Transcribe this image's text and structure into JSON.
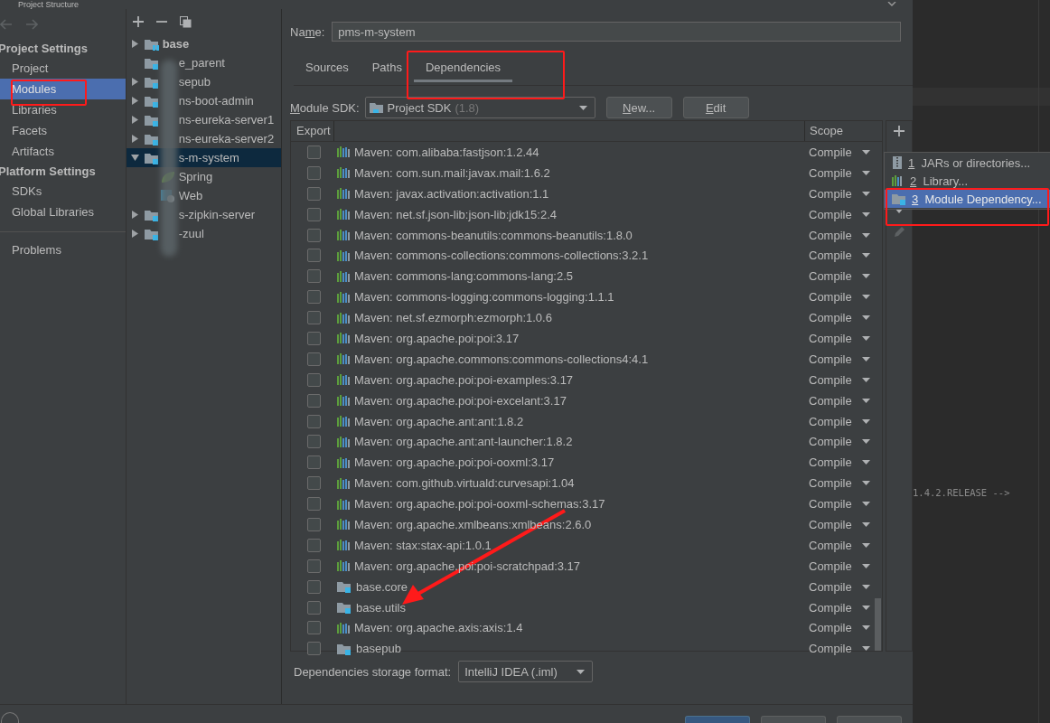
{
  "window": {
    "title": "Project Structure"
  },
  "sidebar": {
    "sections": [
      {
        "title": "Project Settings",
        "items": [
          {
            "label": "Project",
            "selected": false
          },
          {
            "label": "Modules",
            "selected": true
          },
          {
            "label": "Libraries",
            "selected": false
          },
          {
            "label": "Facets",
            "selected": false
          },
          {
            "label": "Artifacts",
            "selected": false
          }
        ]
      },
      {
        "title": "Platform Settings",
        "items": [
          {
            "label": "SDKs",
            "selected": false
          },
          {
            "label": "Global Libraries",
            "selected": false
          }
        ]
      }
    ],
    "problems": {
      "label": "Problems",
      "selected": false
    }
  },
  "tree": [
    {
      "label": "base",
      "kind": "root",
      "expandable": true,
      "expanded": false,
      "selected": false
    },
    {
      "label": "e_parent",
      "kind": "module",
      "expandable": false,
      "selected": false
    },
    {
      "label": "sepub",
      "kind": "module",
      "expandable": true,
      "expanded": false,
      "selected": false
    },
    {
      "label": "ns-boot-admin",
      "kind": "module",
      "expandable": true,
      "expanded": false,
      "selected": false
    },
    {
      "label": "ns-eureka-server1",
      "kind": "module",
      "expandable": true,
      "expanded": false,
      "selected": false
    },
    {
      "label": "ns-eureka-server2",
      "kind": "module",
      "expandable": true,
      "expanded": false,
      "selected": false
    },
    {
      "label": "s-m-system",
      "kind": "module",
      "expandable": true,
      "expanded": true,
      "selected": true,
      "children": [
        {
          "label": "Spring",
          "kind": "spring",
          "selected": false
        },
        {
          "label": "Web",
          "kind": "web",
          "selected": false
        }
      ]
    },
    {
      "label": "s-zipkin-server",
      "kind": "module",
      "expandable": true,
      "expanded": false,
      "selected": false
    },
    {
      "label": "-zuul",
      "kind": "module",
      "expandable": true,
      "expanded": false,
      "selected": false
    }
  ],
  "name_field": {
    "label": {
      "before": "Na",
      "key": "m",
      "rest": "e:"
    },
    "value": "pms-m-system"
  },
  "tabs": [
    {
      "label": "Sources",
      "selected": false
    },
    {
      "label": "Paths",
      "selected": false
    },
    {
      "label": "Dependencies",
      "selected": true
    }
  ],
  "module_sdk": {
    "label": {
      "key": "M",
      "rest": "odule SDK:"
    },
    "value": "Project SDK",
    "version": "(1.8)",
    "buttons": [
      {
        "key": "N",
        "rest": "ew..."
      },
      {
        "key": "E",
        "rest": "dit"
      }
    ]
  },
  "table": {
    "columns": [
      "Export",
      "Scope"
    ],
    "rows": [
      {
        "kind": "library",
        "name": "Maven: com.alibaba:fastjson:1.2.44",
        "export": false,
        "scope": "Compile"
      },
      {
        "kind": "library",
        "name": "Maven: com.sun.mail:javax.mail:1.6.2",
        "export": false,
        "scope": "Compile"
      },
      {
        "kind": "library",
        "name": "Maven: javax.activation:activation:1.1",
        "export": false,
        "scope": "Compile"
      },
      {
        "kind": "library",
        "name": "Maven: net.sf.json-lib:json-lib:jdk15:2.4",
        "export": false,
        "scope": "Compile"
      },
      {
        "kind": "library",
        "name": "Maven: commons-beanutils:commons-beanutils:1.8.0",
        "export": false,
        "scope": "Compile"
      },
      {
        "kind": "library",
        "name": "Maven: commons-collections:commons-collections:3.2.1",
        "export": false,
        "scope": "Compile"
      },
      {
        "kind": "library",
        "name": "Maven: commons-lang:commons-lang:2.5",
        "export": false,
        "scope": "Compile"
      },
      {
        "kind": "library",
        "name": "Maven: commons-logging:commons-logging:1.1.1",
        "export": false,
        "scope": "Compile"
      },
      {
        "kind": "library",
        "name": "Maven: net.sf.ezmorph:ezmorph:1.0.6",
        "export": false,
        "scope": "Compile"
      },
      {
        "kind": "library",
        "name": "Maven: org.apache.poi:poi:3.17",
        "export": false,
        "scope": "Compile"
      },
      {
        "kind": "library",
        "name": "Maven: org.apache.commons:commons-collections4:4.1",
        "export": false,
        "scope": "Compile"
      },
      {
        "kind": "library",
        "name": "Maven: org.apache.poi:poi-examples:3.17",
        "export": false,
        "scope": "Compile"
      },
      {
        "kind": "library",
        "name": "Maven: org.apache.poi:poi-excelant:3.17",
        "export": false,
        "scope": "Compile"
      },
      {
        "kind": "library",
        "name": "Maven: org.apache.ant:ant:1.8.2",
        "export": false,
        "scope": "Compile"
      },
      {
        "kind": "library",
        "name": "Maven: org.apache.ant:ant-launcher:1.8.2",
        "export": false,
        "scope": "Compile"
      },
      {
        "kind": "library",
        "name": "Maven: org.apache.poi:poi-ooxml:3.17",
        "export": false,
        "scope": "Compile"
      },
      {
        "kind": "library",
        "name": "Maven: com.github.virtuald:curvesapi:1.04",
        "export": false,
        "scope": "Compile"
      },
      {
        "kind": "library",
        "name": "Maven: org.apache.poi:poi-ooxml-schemas:3.17",
        "export": false,
        "scope": "Compile"
      },
      {
        "kind": "library",
        "name": "Maven: org.apache.xmlbeans:xmlbeans:2.6.0",
        "export": false,
        "scope": "Compile"
      },
      {
        "kind": "library",
        "name": "Maven: stax:stax-api:1.0.1",
        "export": false,
        "scope": "Compile"
      },
      {
        "kind": "library",
        "name": "Maven: org.apache.poi:poi-scratchpad:3.17",
        "export": false,
        "scope": "Compile"
      },
      {
        "kind": "module",
        "name": "base.core",
        "export": false,
        "scope": "Compile"
      },
      {
        "kind": "module",
        "name": "base.utils",
        "export": false,
        "scope": "Compile"
      },
      {
        "kind": "library",
        "name": "Maven: org.apache.axis:axis:1.4",
        "export": false,
        "scope": "Compile"
      },
      {
        "kind": "module",
        "name": "basepub",
        "export": false,
        "scope": "Compile"
      }
    ]
  },
  "add_menu": [
    {
      "kind": "jar",
      "number": "1",
      "label": "JARs or directories...",
      "selected": false
    },
    {
      "kind": "library",
      "number": "2",
      "label": "Library...",
      "selected": false
    },
    {
      "kind": "module",
      "number": "3",
      "label": "Module Dependency...",
      "selected": true
    }
  ],
  "storage_format": {
    "label": "Dependencies storage format:",
    "value": "IntelliJ IDEA (.iml)"
  },
  "editor": {
    "lines": [
      {
        "text": "1.4.2.RELEASE -->"
      }
    ]
  }
}
